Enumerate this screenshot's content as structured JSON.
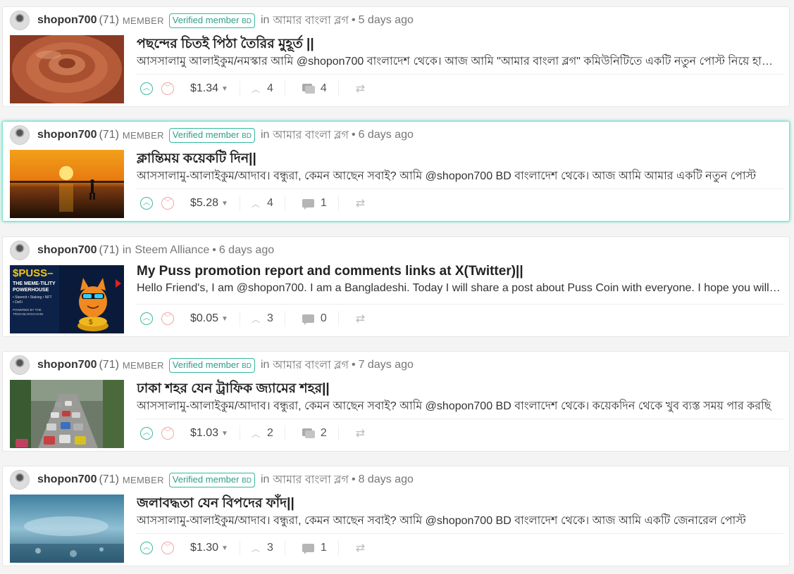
{
  "posts": [
    {
      "author": "shopon700",
      "reputation": "(71)",
      "role": "MEMBER",
      "verified_label": "Verified member",
      "verified_suffix": "BD",
      "in_label": "in",
      "community": "আমার বাংলা ব্লগ",
      "time": "5 days ago",
      "title": "পছন্দের চিতই পিঠা তৈরির মুহূর্ত ||",
      "excerpt": "আসসালামু আলাইকুম/নমস্কার আমি @shopon700 বাংলাদেশ থেকে। আজ আমি \"আমার বাংলা ব্লগ\" কমিউনিটিতে একটি নতুন পোস্ট নিয়ে হাজির হয়েছি",
      "payout": "$1.34",
      "votes": "4",
      "comments": "4",
      "thumb_icon": "clay-pot-image"
    },
    {
      "author": "shopon700",
      "reputation": "(71)",
      "role": "MEMBER",
      "verified_label": "Verified member",
      "verified_suffix": "BD",
      "in_label": "in",
      "community": "আমার বাংলা ব্লগ",
      "time": "6 days ago",
      "title": "ক্লান্তিময় কয়েকটি দিন||",
      "excerpt": "আসসালামু-আলাইকুম/আদাব। বন্ধুরা, কেমন আছেন সবাই? আমি @shopon700 BD বাংলাদেশ থেকে। আজ আমি আমার একটি নতুন পোস্ট",
      "payout": "$5.28",
      "votes": "4",
      "comments": "1",
      "thumb_icon": "sunset-beach-image"
    },
    {
      "author": "shopon700",
      "reputation": "(71)",
      "role": "",
      "verified_label": "",
      "verified_suffix": "",
      "in_label": "in",
      "community": "Steem Alliance",
      "time": "6 days ago",
      "title": "My Puss promotion report and comments links at X(Twitter)||",
      "excerpt": "Hello Friend's, I am @shopon700. I am a Bangladeshi. Today I will share a post about Puss Coin with everyone. I hope you will like it",
      "payout": "$0.05",
      "votes": "3",
      "comments": "0",
      "thumb_icon": "puss-coin-image",
      "thumb_text": {
        "line1": "$PUSS–",
        "line2": "THE MEME-TILITY",
        "line3": "POWERHOUSE",
        "line4": "• Steemit • Staking • NFT",
        "line5": "• DeFi",
        "line6": "POWERED BY THE",
        "line7": "TRON BLOCKCHAIN"
      }
    },
    {
      "author": "shopon700",
      "reputation": "(71)",
      "role": "MEMBER",
      "verified_label": "Verified member",
      "verified_suffix": "BD",
      "in_label": "in",
      "community": "আমার বাংলা ব্লগ",
      "time": "7 days ago",
      "title": "ঢাকা শহর যেন ট্রাফিক জ্যামের শহর||",
      "excerpt": "আসসালামু-আলাইকুম/আদাব। বন্ধুরা, কেমন আছেন সবাই? আমি @shopon700 BD বাংলাদেশ থেকে। কয়েকদিন থেকে খুব ব্যস্ত সময় পার করছি",
      "payout": "$1.03",
      "votes": "2",
      "comments": "2",
      "thumb_icon": "traffic-jam-image"
    },
    {
      "author": "shopon700",
      "reputation": "(71)",
      "role": "MEMBER",
      "verified_label": "Verified member",
      "verified_suffix": "BD",
      "in_label": "in",
      "community": "আমার বাংলা ব্লগ",
      "time": "8 days ago",
      "title": "জলাবদ্ধতা যেন বিপদের ফাঁদ||",
      "excerpt": "আসসালামু-আলাইকুম/আদাব। বন্ধুরা, কেমন আছেন সবাই? আমি @shopon700 BD বাংলাদেশ থেকে। আজ আমি একটি জেনারেল পোস্ট",
      "payout": "$1.30",
      "votes": "3",
      "comments": "1",
      "thumb_icon": "rain-storm-image"
    }
  ],
  "colors": {
    "accent": "#3ab89e",
    "downvote": "#f2a6a6",
    "active_border": "#7fe5d2"
  }
}
